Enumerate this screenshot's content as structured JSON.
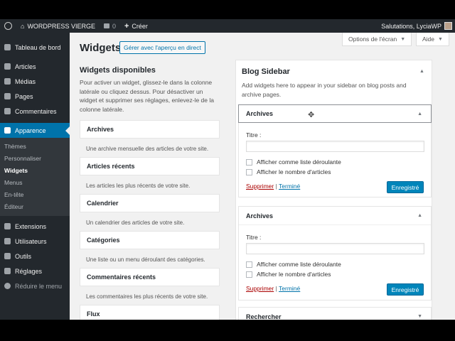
{
  "adminbar": {
    "site_name": "WORDPRESS VIERGE",
    "comments_count": "0",
    "new_label": "Créer",
    "greeting": "Salutations, LyciaWP"
  },
  "sidebar": {
    "items": [
      {
        "label": "Tableau de bord",
        "icon": "dashboard-icon"
      },
      {
        "label": "Articles",
        "icon": "pin-icon"
      },
      {
        "label": "Médias",
        "icon": "media-icon"
      },
      {
        "label": "Pages",
        "icon": "page-icon"
      },
      {
        "label": "Commentaires",
        "icon": "comment-icon"
      },
      {
        "label": "Apparence",
        "icon": "brush-icon"
      }
    ],
    "submenu": [
      "Thèmes",
      "Personnaliser",
      "Widgets",
      "Menus",
      "En-tête",
      "Éditeur"
    ],
    "items_after": [
      {
        "label": "Extensions",
        "icon": "plugin-icon"
      },
      {
        "label": "Utilisateurs",
        "icon": "users-icon"
      },
      {
        "label": "Outils",
        "icon": "wrench-icon"
      },
      {
        "label": "Réglages",
        "icon": "settings-icon"
      }
    ],
    "collapse": "Réduire le menu"
  },
  "screen_options": "Options de l'écran",
  "help": "Aide",
  "page": {
    "title": "Widgets",
    "manage_live": "Gérer avec l'aperçu en direct"
  },
  "available": {
    "title": "Widgets disponibles",
    "description": "Pour activer un widget, glissez-le dans la colonne latérale ou cliquez dessus. Pour désactiver un widget et supprimer ses réglages, enlevez-le de la colonne latérale.",
    "widgets": [
      {
        "name": "Archives",
        "desc": "Une archive mensuelle des articles de votre site."
      },
      {
        "name": "Articles récents",
        "desc": "Les articles les plus récents de votre site."
      },
      {
        "name": "Calendrier",
        "desc": "Un calendrier des articles de votre site."
      },
      {
        "name": "Catégories",
        "desc": "Une liste ou un menu déroulant des catégories."
      },
      {
        "name": "Commentaires récents",
        "desc": "Les commentaires les plus récents de votre site."
      },
      {
        "name": "Flux",
        "desc": ""
      }
    ]
  },
  "blog_sidebar": {
    "title": "Blog Sidebar",
    "description": "Add widgets here to appear in your sidebar on blog posts and archive pages.",
    "instances": [
      {
        "name": "Archives",
        "title_label": "Titre :",
        "opt1": "Afficher comme liste déroulante",
        "opt2": "Afficher le nombre d'articles",
        "delete": "Supprimer",
        "separator": "|",
        "done": "Terminé",
        "save": "Enregistré"
      },
      {
        "name": "Archives",
        "title_label": "Titre :",
        "opt1": "Afficher comme liste déroulante",
        "opt2": "Afficher le nombre d'articles",
        "delete": "Supprimer",
        "separator": "|",
        "done": "Terminé",
        "save": "Enregistré"
      }
    ],
    "collapsed": "Rechercher"
  }
}
